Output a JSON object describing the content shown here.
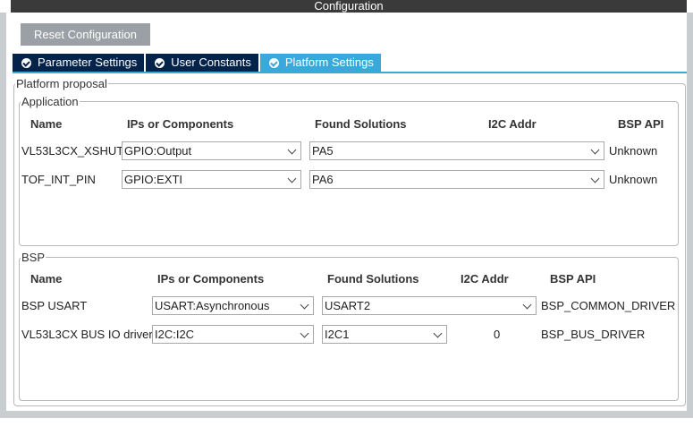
{
  "window": {
    "title": "Configuration"
  },
  "toolbar": {
    "reset_label": "Reset Configuration"
  },
  "tabs": [
    {
      "label": "Parameter Settings",
      "active": false
    },
    {
      "label": "User Constants",
      "active": false
    },
    {
      "label": "Platform Settings",
      "active": true
    }
  ],
  "platform_proposal": {
    "legend": "Platform proposal",
    "application": {
      "legend": "Application",
      "headers": {
        "name": "Name",
        "ips": "IPs or Components",
        "found": "Found Solutions",
        "i2c": "I2C Addr",
        "bsp_api": "BSP API"
      },
      "rows": [
        {
          "name": "VL53L3CX_XSHUT",
          "ip": "GPIO:Output",
          "found": "PA5",
          "i2c": "",
          "bsp_api": "Unknown"
        },
        {
          "name": "TOF_INT_PIN",
          "ip": "GPIO:EXTI",
          "found": "PA6",
          "i2c": "",
          "bsp_api": "Unknown"
        }
      ]
    },
    "bsp": {
      "legend": "BSP",
      "headers": {
        "name": "Name",
        "ips": "IPs or Components",
        "found": "Found Solutions",
        "i2c": "I2C Addr",
        "bsp_api": "BSP API"
      },
      "rows": [
        {
          "name": "BSP USART",
          "ip": "USART:Asynchronous",
          "found": "USART2",
          "i2c": "",
          "bsp_api": "BSP_COMMON_DRIVER"
        },
        {
          "name": "VL53L3CX BUS IO driver",
          "ip": "I2C:I2C",
          "found": "I2C1",
          "i2c": "0",
          "bsp_api": "BSP_BUS_DRIVER"
        }
      ]
    }
  },
  "colors": {
    "tab_active": "#39a9dc",
    "tab_inactive": "#03234b",
    "button": "#9aa0a6"
  }
}
